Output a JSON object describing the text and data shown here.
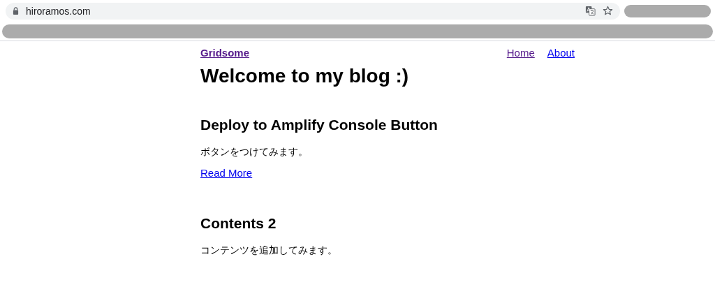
{
  "browser": {
    "address": "hiroramos.com"
  },
  "header": {
    "logo": "Gridsome",
    "nav": [
      {
        "label": "Home"
      },
      {
        "label": "About"
      }
    ]
  },
  "page_title": "Welcome to my blog :)",
  "posts": [
    {
      "title": "Deploy to Amplify Console Button",
      "excerpt": "ボタンをつけてみます。",
      "link": "Read More"
    },
    {
      "title": "Contents 2",
      "excerpt": "コンテンツを追加してみます。"
    }
  ]
}
